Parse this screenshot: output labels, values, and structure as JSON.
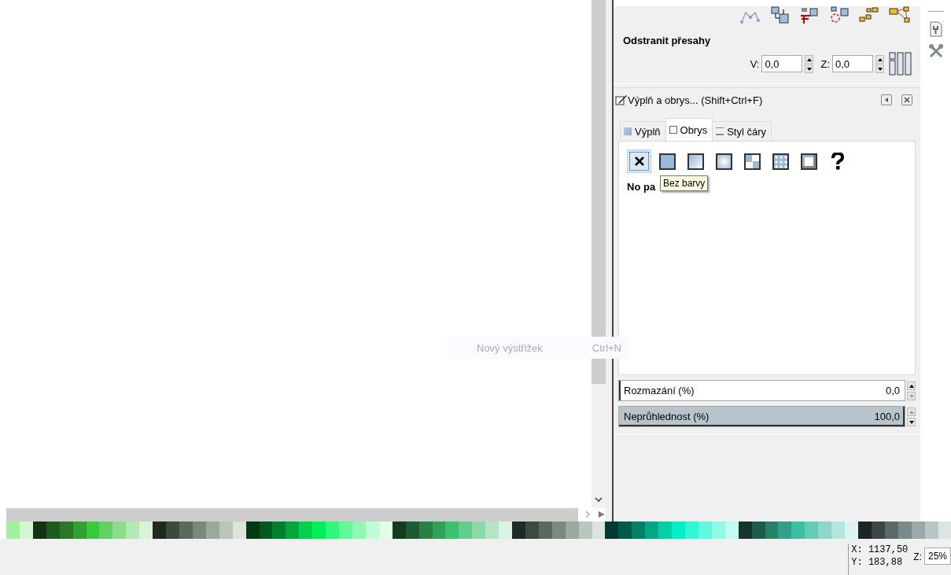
{
  "remove_overlaps": {
    "title": "Odstranit přesahy",
    "fields": [
      {
        "label": "V:",
        "value": "0,0"
      },
      {
        "label": "Z:",
        "value": "0,0"
      }
    ]
  },
  "dock": {
    "title": "Výplň a obrys... (Shift+Ctrl+F)",
    "tabs": [
      {
        "label": "Výplň",
        "kind": "fill",
        "selected": false
      },
      {
        "label": "Obrys",
        "kind": "stroke",
        "selected": true
      },
      {
        "label": "Styl čáry",
        "kind": "style",
        "selected": false
      }
    ],
    "paint_modes": [
      {
        "kind": "none",
        "selected": true
      },
      {
        "kind": "flat",
        "selected": false
      },
      {
        "kind": "linear",
        "selected": false
      },
      {
        "kind": "radial",
        "selected": false
      },
      {
        "kind": "mesh",
        "selected": false
      },
      {
        "kind": "pattern",
        "selected": false
      },
      {
        "kind": "swatch",
        "selected": false
      },
      {
        "kind": "unset",
        "selected": false
      }
    ],
    "paint_label": "No pa",
    "tooltip": "Bez barvy",
    "blur": {
      "label": "Rozmazání (%)",
      "value": "0,0",
      "level": 0
    },
    "opacity": {
      "label": "Neprůhlednost (%)",
      "value": "100,0",
      "level": 1
    }
  },
  "ghost_menu_item": {
    "label": "Nový výstřižek",
    "shortcut": "Ctrl+N"
  },
  "palette": [
    {
      "color": "#a0f0a0"
    },
    {
      "color": "#d0f8d0"
    },
    {
      "color": "#143214"
    },
    {
      "color": "#1e5a1e"
    },
    {
      "color": "#287828"
    },
    {
      "color": "#32a032"
    },
    {
      "color": "#3cc83c"
    },
    {
      "color": "#64d064"
    },
    {
      "color": "#8cdc8c"
    },
    {
      "color": "#b4e8b4"
    },
    {
      "color": "#d8f4d8"
    },
    {
      "color": "#1e2a1e"
    },
    {
      "color": "#3c4a3c"
    },
    {
      "color": "#5a6a5a"
    },
    {
      "color": "#7a8a7a"
    },
    {
      "color": "#9aaa9a"
    },
    {
      "color": "#bac6ba"
    },
    {
      "color": "#dce4dc"
    },
    {
      "color": "#003a14"
    },
    {
      "color": "#005a20"
    },
    {
      "color": "#00802e"
    },
    {
      "color": "#00a83c"
    },
    {
      "color": "#00d04a"
    },
    {
      "color": "#00f05a"
    },
    {
      "color": "#30f87a"
    },
    {
      "color": "#60f898"
    },
    {
      "color": "#90f8b4"
    },
    {
      "color": "#c0fcd4"
    },
    {
      "color": "#e0fee8"
    },
    {
      "color": "#143a20"
    },
    {
      "color": "#1e5a32"
    },
    {
      "color": "#288046"
    },
    {
      "color": "#32a05a"
    },
    {
      "color": "#3cc06e"
    },
    {
      "color": "#64cc8c"
    },
    {
      "color": "#8cd8a8"
    },
    {
      "color": "#b4e4c8"
    },
    {
      "color": "#dcf2e4"
    },
    {
      "color": "#1e2a24"
    },
    {
      "color": "#3c4a42"
    },
    {
      "color": "#5a6a60"
    },
    {
      "color": "#7a8a80"
    },
    {
      "color": "#9aaaa0"
    },
    {
      "color": "#bac6c0"
    },
    {
      "color": "#dce4e0"
    },
    {
      "color": "#003a30"
    },
    {
      "color": "#005a4a"
    },
    {
      "color": "#008066"
    },
    {
      "color": "#00a886"
    },
    {
      "color": "#00d0a8"
    },
    {
      "color": "#00f0c8"
    },
    {
      "color": "#30f8d4"
    },
    {
      "color": "#60f8de"
    },
    {
      "color": "#90fae8"
    },
    {
      "color": "#c0fcf2"
    },
    {
      "color": "#14342c"
    },
    {
      "color": "#1e5a4a"
    },
    {
      "color": "#288068"
    },
    {
      "color": "#32a088"
    },
    {
      "color": "#3cc0a4"
    },
    {
      "color": "#64ccb4"
    },
    {
      "color": "#8cd8c8"
    },
    {
      "color": "#b4e6dc"
    },
    {
      "color": "#dcf4f0"
    },
    {
      "color": "#1e2424"
    },
    {
      "color": "#3c4646"
    },
    {
      "color": "#5a6a6a"
    },
    {
      "color": "#7a8a8a"
    },
    {
      "color": "#9aaaaa"
    },
    {
      "color": "#bac6c6"
    },
    {
      "color": "#dce4e4"
    }
  ],
  "status": {
    "x": "X: 1137,50",
    "y": "Y: 183,88",
    "zoom_label": "Z:",
    "zoom": "25%"
  }
}
